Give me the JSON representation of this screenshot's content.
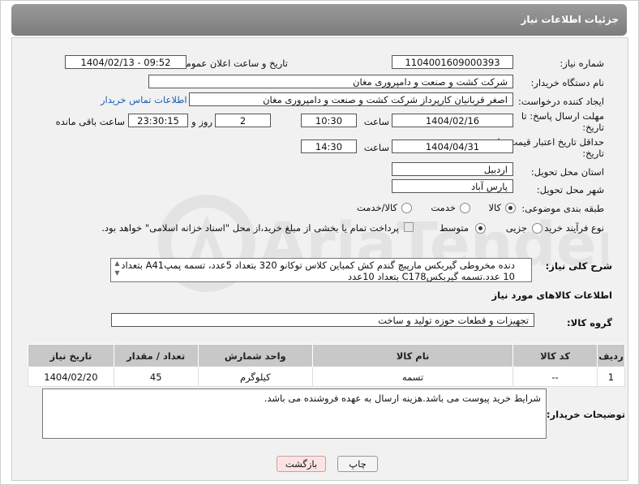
{
  "header": {
    "title": "جزئیات اطلاعات نیاز"
  },
  "form": {
    "need_number_label": "شماره نیاز:",
    "need_number": "1104001609000393",
    "announce_label": "تاریخ و ساعت اعلان عمومی:",
    "announce_value": "1404/02/13 - 09:52",
    "buyer_org_label": "نام دستگاه خریدار:",
    "buyer_org": "شرکت کشت و صنعت و دامپروری مغان",
    "creator_label": "ایجاد کننده درخواست:",
    "creator": "اصغر قربانیان کارپرداز شرکت کشت و صنعت و دامپروری مغان",
    "contact_link": "اطلاعات تماس خریدار",
    "deadline_label": "مهلت ارسال پاسخ: تا تاریخ:",
    "deadline_date": "1404/02/16",
    "time_label": "ساعت",
    "deadline_time": "10:30",
    "days_value": "2",
    "days_label": "روز و",
    "remaining_time": "23:30:15",
    "remaining_label": "ساعت باقی مانده",
    "validity_label": "حداقل تاریخ اعتبار قیمت: تا تاریخ:",
    "validity_date": "1404/04/31",
    "validity_time": "14:30",
    "province_label": "استان محل تحویل:",
    "province": "اردبیل",
    "city_label": "شهر محل تحویل:",
    "city": "پارس آباد",
    "category_label": "طبقه بندی موضوعی:",
    "category_options": [
      "کالا",
      "خدمت",
      "کالا/خدمت"
    ],
    "process_label": "نوع فرآیند خرید :",
    "process_options": [
      "جزیی",
      "متوسط"
    ],
    "payment_note": "پرداخت تمام یا بخشی از مبلغ خرید،از محل \"اسناد خزانه اسلامی\" خواهد بود.",
    "desc_label": "شرح کلی نیاز:",
    "description": "دنده مخروطی گیربکس مارپیچ گندم کش کمباین کلاس توکانو 320 بتعداد 5عدد، تسمه پمپA41 بتعداد 10 عدد.تسمه گیربکسC178 بتعداد 10عدد"
  },
  "goods": {
    "section_title": "اطلاعات کالاهای مورد نیاز",
    "group_label": "گروه کالا:",
    "group_value": "تجهیزات و قطعات حوزه تولید و ساخت",
    "columns": [
      "ردیف",
      "کد کالا",
      "نام کالا",
      "واحد شمارش",
      "تعداد / مقدار",
      "تاریخ نیاز"
    ],
    "rows": [
      {
        "row": "1",
        "code": "--",
        "name": "تسمه",
        "unit": "کیلوگرم",
        "qty": "45",
        "date": "1404/02/20"
      }
    ]
  },
  "buyer_notes": {
    "label": "توضیحات خریدار:",
    "text": "شرایط خرید پیوست می باشد.هزینه ارسال به عهده فروشنده می باشد."
  },
  "buttons": {
    "print": "چاپ",
    "back": "بازگشت"
  },
  "watermark": {
    "text": "AriaTender.net"
  }
}
